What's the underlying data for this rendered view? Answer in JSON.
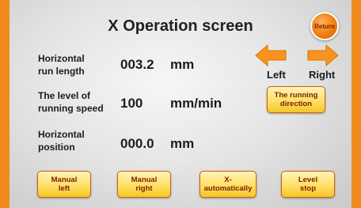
{
  "screen": {
    "title": "X Operation screen",
    "return_label": "Return"
  },
  "fields": {
    "run_length": {
      "label_line1": "Horizontal",
      "label_line2": "run length",
      "value": "003.2",
      "unit": "mm"
    },
    "speed": {
      "label_line1": "The level of",
      "label_line2": "running speed",
      "value": "100",
      "unit": "mm/min"
    },
    "position": {
      "label_line1": "Horizontal",
      "label_line2": "position",
      "value": "000.0",
      "unit": "mm"
    }
  },
  "direction": {
    "left_label": "Left",
    "right_label": "Right",
    "button_line1": "The running",
    "button_line2": "direction"
  },
  "buttons": {
    "manual_left": {
      "line1": "Manual",
      "line2": "left"
    },
    "manual_right": {
      "line1": "Manual",
      "line2": "right"
    },
    "x_auto": {
      "line1": "X-",
      "line2": "automatically"
    },
    "level_stop": {
      "line1": "Level",
      "line2": "stop"
    }
  },
  "colors": {
    "frame": "#f08a1c",
    "button_fill": "#ffe066",
    "button_text": "#7a1f00",
    "arrow": "#f7931e"
  }
}
